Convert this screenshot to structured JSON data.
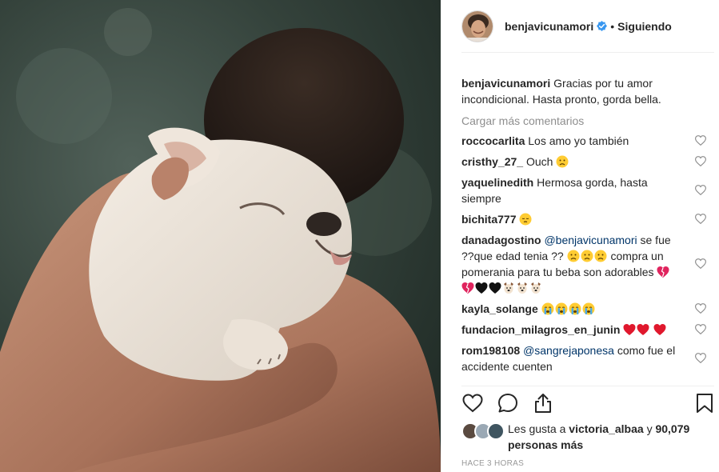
{
  "post": {
    "username": "benjavicunamori",
    "follow_status": "Siguiendo",
    "separator": "•",
    "verified": true,
    "caption_text": "Gracias por tu amor incondicional. Hasta pronto, gorda bella.",
    "load_more": "Cargar más comentarios",
    "likes_prefix": "Les gusta a",
    "likes_user": "victoria_albaa",
    "likes_and": "y",
    "likes_count": "90,079",
    "likes_suffix": "personas más",
    "time": "HACE 3 HORAS"
  },
  "comments": [
    {
      "user": "roccocarlita",
      "text": "Los amo yo también",
      "emojis": []
    },
    {
      "user": "cristhy_27_",
      "text": "Ouch",
      "emojis": [
        "sad-face"
      ]
    },
    {
      "user": "yaquelinedith",
      "text": "Hermosa gorda, hasta siempre",
      "emojis": []
    },
    {
      "user": "bichita777",
      "text": "",
      "emojis": [
        "pensive-face"
      ]
    },
    {
      "user": "danadagostino",
      "mention": "@benjavicunamori",
      "text": "se fue ??que edad tenia ??",
      "text2": "compra un pomerania para tu beba son adorables",
      "emojis": [
        "sad-face",
        "sad-face",
        "sad-face"
      ],
      "emojis2": [
        "broken-heart",
        "broken-heart",
        "black-heart",
        "black-heart",
        "dog-face",
        "dog-face",
        "dog-face"
      ]
    },
    {
      "user": "kayla_solange",
      "text": "",
      "emojis": [
        "crying-face",
        "crying-face",
        "crying-face",
        "crying-face"
      ]
    },
    {
      "user": "fundacion_milagros_en_junin",
      "text": "",
      "emojis": [
        "red-heart",
        "red-heart",
        "red-heart"
      ]
    },
    {
      "user": "rom198108",
      "mention": "@sangrejaponesa",
      "text": "como fue el accidente cuenten",
      "emojis": []
    }
  ],
  "icons": {
    "like": "heart-outline-icon",
    "comment": "speech-bubble-icon",
    "share": "share-icon",
    "save": "bookmark-icon",
    "verified": "verified-badge-icon"
  },
  "colors": {
    "text": "#262626",
    "muted": "#8e8e8e",
    "mention": "#003569",
    "verified": "#3897f0",
    "divider": "#efefef"
  }
}
